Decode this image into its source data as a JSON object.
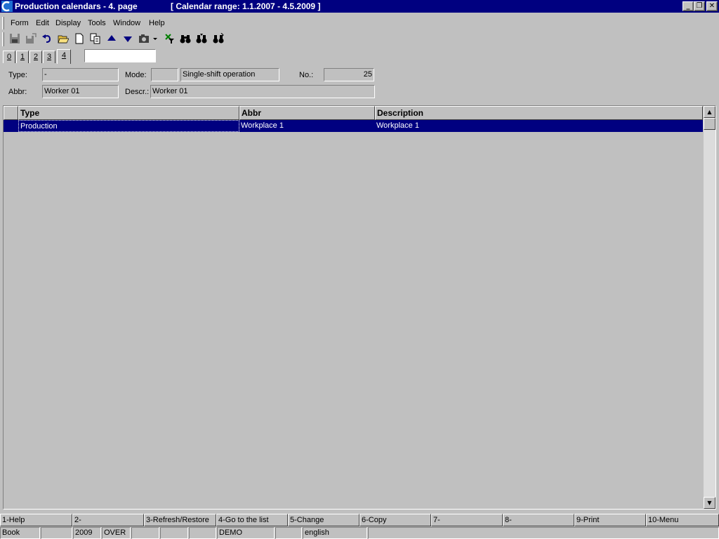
{
  "window": {
    "title": "Production calendars - 4. page",
    "range": "[ Calendar range: 1.1.2007 - 4.5.2009 ]",
    "minimize_glyph": "_",
    "restore_glyph": "❐",
    "close_glyph": "✕"
  },
  "menu": {
    "items": [
      "Form",
      "Edit",
      "Display",
      "Tools",
      "Window",
      "Help"
    ]
  },
  "toolbar": {
    "icons": [
      "save-icon",
      "save-as-icon",
      "undo-icon",
      "open-folder-icon",
      "new-document-icon",
      "copy-icon",
      "arrow-up-icon",
      "arrow-down-icon",
      "camera-icon",
      "dropdown-arrow-icon",
      "filter-icon",
      "binoculars-icon",
      "find-next-icon",
      "find-prev-icon"
    ]
  },
  "tabs": {
    "items": [
      "0",
      "1",
      "2",
      "3",
      "4"
    ],
    "active": "4",
    "input_value": ""
  },
  "header": {
    "type_label": "Type:",
    "type_value": "-",
    "mode_label": "Mode:",
    "mode_value": "",
    "mode_desc": "Single-shift operation",
    "no_label": "No.:",
    "no_value": "25",
    "abbr_label": "Abbr:",
    "abbr_value": "Worker 01",
    "descr_label": "Descr.:",
    "descr_value": "Worker 01"
  },
  "grid": {
    "columns": [
      "Type",
      "Abbr",
      "Description"
    ],
    "rows": [
      [
        "Production",
        "Workplace 1",
        "Workplace 1"
      ]
    ]
  },
  "fkeys": [
    "1-Help",
    "2-",
    "3-Refresh/Restore",
    "4-Go to the list",
    "5-Change",
    "6-Copy",
    "7-",
    "8-",
    "9-Print",
    "10-Menu"
  ],
  "status": {
    "panels": [
      "Book",
      "",
      "2009",
      "OVER",
      "",
      "",
      "",
      "DEMO",
      "",
      "english",
      ""
    ]
  },
  "colors": {
    "title_bar": "#000080",
    "selection": "#000080",
    "face": "#c0c0c0"
  }
}
